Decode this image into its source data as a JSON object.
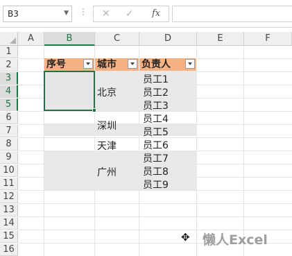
{
  "name_box": {
    "value": "B3"
  },
  "formula_bar": {
    "cancel": "✕",
    "confirm": "✓",
    "fx": "fx",
    "value": ""
  },
  "columns": [
    "A",
    "B",
    "C",
    "D",
    "E",
    "F"
  ],
  "selected_column": "B",
  "rows": [
    "1",
    "2",
    "3",
    "4",
    "5",
    "6",
    "7",
    "8",
    "9",
    "10",
    "11",
    "12",
    "13",
    "14",
    "15",
    "16"
  ],
  "selected_rows": [
    "3",
    "4",
    "5"
  ],
  "table": {
    "headers": [
      "序号",
      "城市",
      "负责人"
    ],
    "cities": [
      "北京",
      "深圳",
      "天津",
      "广州"
    ],
    "staff": [
      "员工1",
      "员工2",
      "员工3",
      "员工4",
      "员工5",
      "员工6",
      "员工7",
      "员工8",
      "员工9"
    ]
  },
  "watermark": "懒人Excel",
  "colors": {
    "header_fill": "#f4b183",
    "band_fill": "#e8e8e8",
    "selection": "#217346"
  }
}
